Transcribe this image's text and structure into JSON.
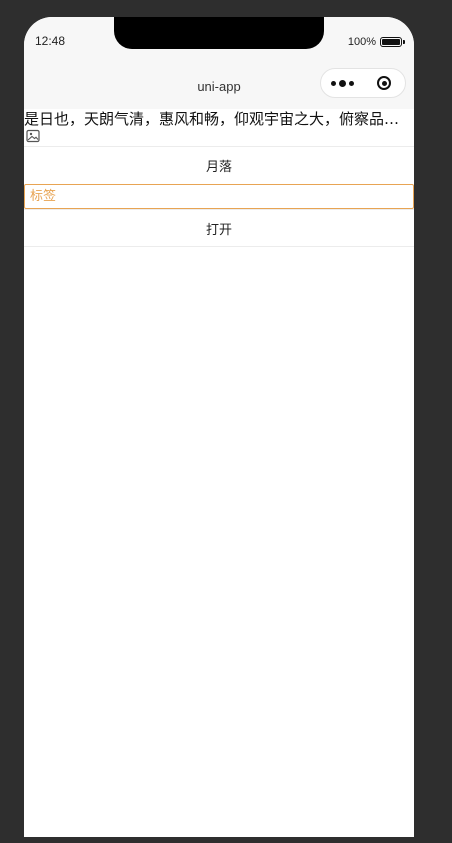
{
  "status": {
    "time": "12:48",
    "battery": "100%"
  },
  "nav": {
    "title": "uni-app"
  },
  "content": {
    "long_text": "是日也，天朗气清，惠风和畅，仰观宇宙之大，俯察品类之盛",
    "moon_button": "月落",
    "tag_input": {
      "value": "",
      "placeholder": "标签"
    },
    "open_button": "打开"
  },
  "colors": {
    "background": "#2e2e2e",
    "input_border": "#e8a453",
    "navbar": "#f7f7f7"
  }
}
